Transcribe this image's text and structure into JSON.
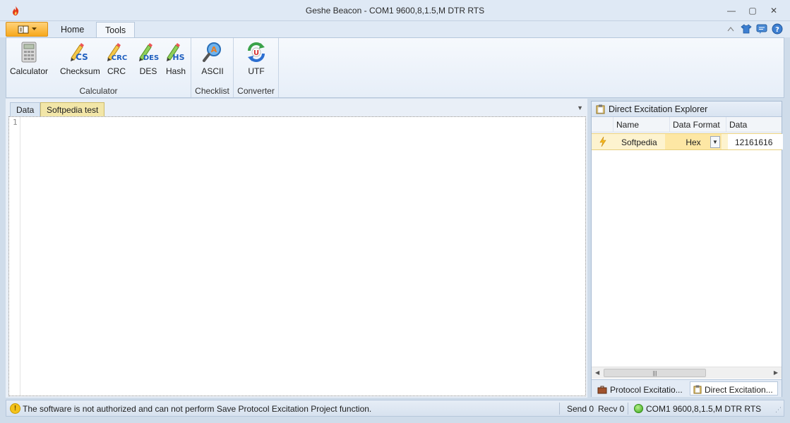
{
  "window": {
    "title": "Geshe Beacon - COM1  9600,8,1.5,M  DTR  RTS",
    "minimize": "—",
    "restore": "▢",
    "close": "✕"
  },
  "ribbon": {
    "tabs": [
      {
        "label": "Home"
      },
      {
        "label": "Tools"
      }
    ],
    "groups": [
      {
        "label": "Calculator",
        "buttons": [
          {
            "label": "Calculator",
            "icon": "calculator-icon"
          },
          {
            "label": "Checksum",
            "icon": "checksum-icon",
            "badge": "CS"
          },
          {
            "label": "CRC",
            "icon": "crc-icon",
            "badge": "CRC"
          },
          {
            "label": "DES",
            "icon": "des-icon",
            "badge": "DES"
          },
          {
            "label": "Hash",
            "icon": "hash-icon",
            "badge": "HS"
          }
        ]
      },
      {
        "label": "Checklist",
        "buttons": [
          {
            "label": "ASCII",
            "icon": "ascii-icon",
            "badge": "A"
          }
        ]
      },
      {
        "label": "Converter",
        "buttons": [
          {
            "label": "UTF",
            "icon": "utf-icon",
            "badge": "U"
          }
        ]
      }
    ]
  },
  "documents": {
    "tabs": [
      {
        "label": "Data"
      },
      {
        "label": "Softpedia test"
      }
    ],
    "editor": {
      "line_number": "1"
    }
  },
  "explorer": {
    "title": "Direct Excitation Explorer",
    "columns": [
      "Name",
      "Data Format",
      "Data"
    ],
    "rows": [
      {
        "name": "Softpedia",
        "format": "Hex",
        "data": "12161616"
      }
    ],
    "scroll_thumb": "|||",
    "scroll_left": "◀",
    "scroll_right": "▶",
    "bottom_tabs": [
      {
        "label": "Protocol Excitatio..."
      },
      {
        "label": "Direct Excitation..."
      }
    ]
  },
  "status": {
    "warning_mark": "!",
    "message": "The software is not authorized and can not perform Save Protocol Excitation Project function.",
    "send": "Send 0",
    "recv": "Recv 0",
    "port": "COM1  9600,8,1.5,M  DTR  RTS"
  },
  "colors": {
    "accent_orange": "#f7a81c",
    "active_doc_tab": "#f2e6a8",
    "selected_row": "#fdf3cf"
  }
}
